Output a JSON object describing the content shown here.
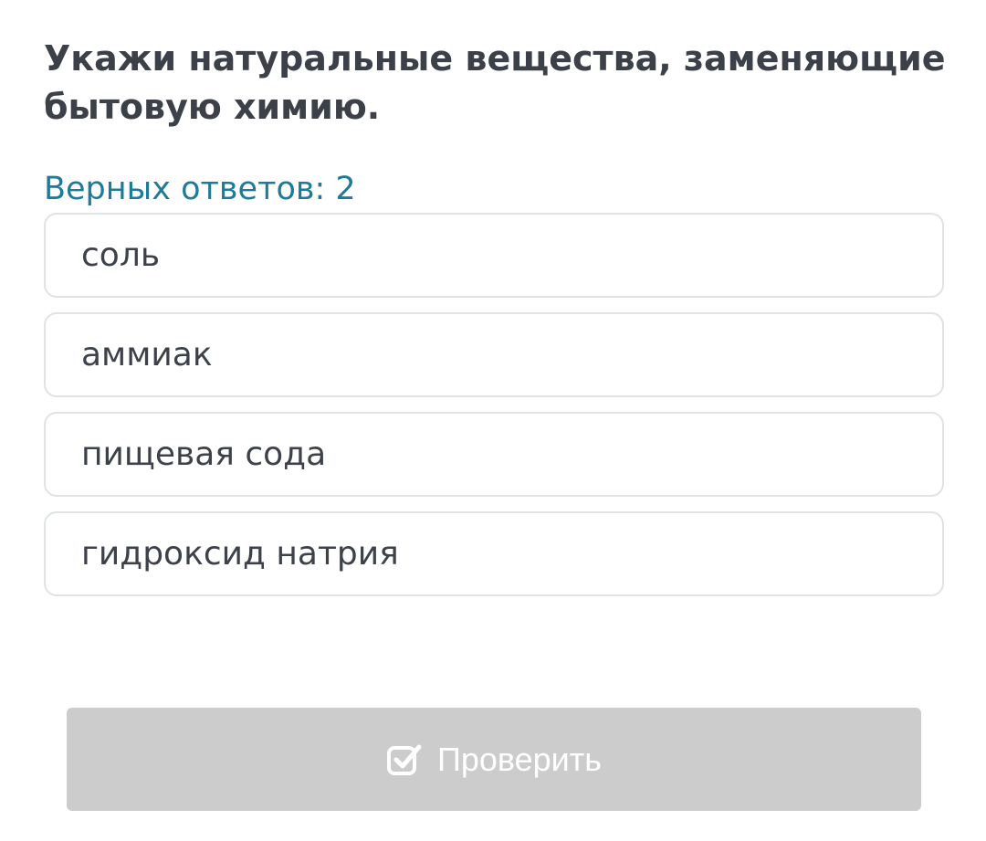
{
  "question": {
    "text": "Укажи натуральные вещества, заменяющие бытовую химию."
  },
  "hint": {
    "text": "Верных ответов: 2"
  },
  "options": [
    {
      "label": "соль"
    },
    {
      "label": "аммиак"
    },
    {
      "label": "пищевая сода"
    },
    {
      "label": "гидроксид натрия"
    }
  ],
  "check_button": {
    "label": "Проверить",
    "icon": "checkbox-check-icon",
    "state": "disabled"
  },
  "colors": {
    "question_text": "#3c4049",
    "hint_text": "#1f7a99",
    "option_border": "#dfe3e6",
    "option_text": "#3d4149",
    "button_background": "#cccccc",
    "button_text": "#ffffff"
  }
}
